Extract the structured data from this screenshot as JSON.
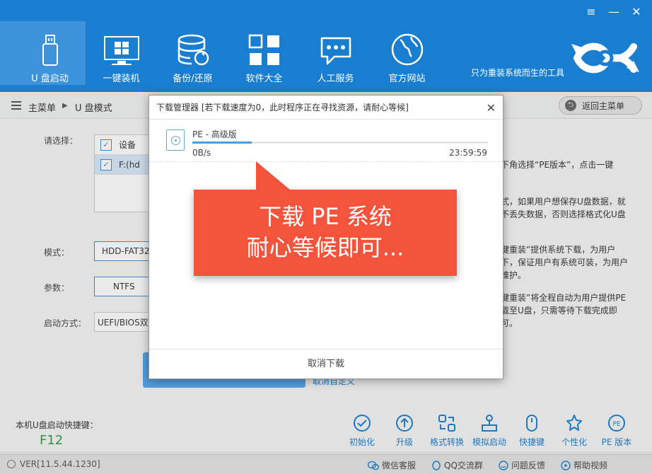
{
  "header": {
    "nav": [
      {
        "label": "U 盘启动",
        "icon": "usb-drive-icon"
      },
      {
        "label": "一键装机",
        "icon": "monitor-windows-icon"
      },
      {
        "label": "备份/还原",
        "icon": "database-restore-icon"
      },
      {
        "label": "软件大全",
        "icon": "apps-grid-icon"
      },
      {
        "label": "人工服务",
        "icon": "chat-bubble-icon"
      },
      {
        "label": "官方网站",
        "icon": "globe-icon"
      }
    ],
    "slogan": "只为重装系统而生的工具",
    "window_controls": {
      "menu": "≡",
      "minimize": "—",
      "close": "✕"
    }
  },
  "breadcrumb": {
    "home": "主菜单",
    "separator": "▶",
    "current": "U 盘模式",
    "back_button": "返回主菜单"
  },
  "main": {
    "select_label": "请选择：",
    "device_header": "设备",
    "device_row": "F:(hd",
    "mode_label": "模式：",
    "mode_value": "HDD-FAT32",
    "param_label": "参数：",
    "param_value": "NTFS",
    "boot_label": "启动方式：",
    "boot_value": "UEFI/BIOS双",
    "custom_link": "取消自定义",
    "side_text_1": "下角选择“PE版本”，点击一键",
    "side_text_2": "式，如果用户想保存U盘数据，就不丢失数据，否则选择格式化U盘",
    "side_text_3": "键重装”提供系统下载，为用户下，保证用户有系统可装，为用户维护。",
    "side_text_4": "键重装”将全程自动为用户提供PE载至U盘，只需等待下载完成即可。"
  },
  "shortcut": {
    "label": "本机U盘启动快捷键：",
    "key": "F12"
  },
  "tools": [
    {
      "label": "初始化",
      "icon": "check-circle-icon"
    },
    {
      "label": "升级",
      "icon": "upgrade-arrow-icon"
    },
    {
      "label": "格式转换",
      "icon": "format-convert-icon"
    },
    {
      "label": "模拟启动",
      "icon": "simulate-boot-icon"
    },
    {
      "label": "快捷键",
      "icon": "mouse-icon"
    },
    {
      "label": "个性化",
      "icon": "personalize-icon"
    },
    {
      "label": "PE 版本",
      "icon": "pe-version-icon"
    }
  ],
  "statusbar": {
    "version": "VER[11.5.44.1230]",
    "links": [
      "微信客服",
      "QQ交流群",
      "问题反馈",
      "帮助视频"
    ]
  },
  "dialog": {
    "title": "下载管理器 [若下载速度为0，此时程序正在寻找资源，请耐心等候]",
    "close": "✕",
    "item_name": "PE - 高级版",
    "progress": 0.2,
    "speed": "0B/s",
    "remaining": "23:59:59",
    "cancel": "取消下载"
  },
  "callout": {
    "line1": "下载 PE 系统",
    "line2": "耐心等候即可..."
  },
  "colors": {
    "header_blue": "#1a7ed0",
    "accent": "#3a8ed8",
    "callout_red": "#f4533c",
    "shortcut_green": "#2a9d4a"
  }
}
